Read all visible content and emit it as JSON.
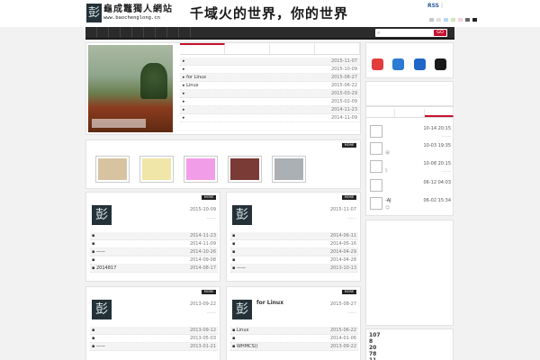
{
  "header": {
    "logo_glyph": "彭",
    "site_name": "龜成鼈獨人網站",
    "site_url": "www.baochenglong.cn",
    "banner_text": "千域火的世界，你的世界",
    "rss_label": "RSS",
    "top_links": "|"
  },
  "search": {
    "placeholder": "",
    "icon": "search-icon",
    "button_label": "GO"
  },
  "hero_list": [
    {
      "title": "",
      "date": "2015-11-07"
    },
    {
      "title": "",
      "date": "2015-10-09"
    },
    {
      "title": "for Linux",
      "date": "2015-08-27"
    },
    {
      "title": "Linux",
      "date": "2015-06-22"
    },
    {
      "title": "",
      "date": "2015-03-29"
    },
    {
      "title": "",
      "date": "2015-02-09"
    },
    {
      "title": "",
      "date": "2014-11-23"
    },
    {
      "title": "",
      "date": "2014-11-09"
    }
  ],
  "more_label": "MORE",
  "friend_thumbs": [
    {
      "color": "#d8c3a1"
    },
    {
      "color": "#efe6a8"
    },
    {
      "color": "#f29de8"
    },
    {
      "color": "#7a3b36"
    },
    {
      "color": "#aab0b3"
    }
  ],
  "articles": [
    {
      "title": "",
      "date": "2015-10-09",
      "ellipsis": "……",
      "items": [
        {
          "title": "",
          "date": "2014-11-23"
        },
        {
          "title": "",
          "date": "2014-11-09"
        },
        {
          "title": "——",
          "date": "2014-10-26"
        },
        {
          "title": "",
          "date": "2014-09-08"
        },
        {
          "title": "2014817",
          "date": "2014-08-17"
        }
      ]
    },
    {
      "title": "",
      "date": "2015-11-07",
      "ellipsis": "……",
      "items": [
        {
          "title": "",
          "date": "2014-06-11"
        },
        {
          "title": "",
          "date": "2014-05-16"
        },
        {
          "title": "",
          "date": "2014-04-29"
        },
        {
          "title": "",
          "date": "2014-04-28"
        },
        {
          "title": "——",
          "date": "2013-10-13"
        }
      ]
    },
    {
      "title": "",
      "date": "2013-09-22",
      "ellipsis": "……",
      "items": [
        {
          "title": "",
          "date": "2013-09-12"
        },
        {
          "title": "",
          "date": "2013-05-03"
        },
        {
          "title": "——",
          "date": "2013-01-21"
        }
      ]
    },
    {
      "title": "for Linux",
      "date": "2015-08-27",
      "ellipsis": "……",
      "items": [
        {
          "title": "Linux",
          "date": "2015-06-22"
        },
        {
          "title": "",
          "date": "2014-01-06"
        },
        {
          "title": "WHMCS()",
          "date": "2013-09-22"
        }
      ]
    }
  ],
  "social_colors": [
    "#e23c3c",
    "#2b7bd3",
    "#1f66c8",
    "#1a1a1a"
  ],
  "comments": [
    {
      "name": "",
      "time": "10-14 20:15",
      "snippet": "",
      "extra": "……"
    },
    {
      "name": "",
      "time": "10-03 19:35",
      "snippet": "😀",
      "extra": ""
    },
    {
      "name": "",
      "time": "10-08 20:15",
      "snippet": "§",
      "extra": "……"
    },
    {
      "name": "",
      "time": "06-12 04:03",
      "snippet": "",
      "extra": ""
    },
    {
      "name": "-AJ",
      "time": "06-02 15:34",
      "snippet": "😊",
      "extra": ""
    }
  ],
  "stat_numbers": [
    "107",
    "8",
    "20",
    "78",
    "11"
  ]
}
